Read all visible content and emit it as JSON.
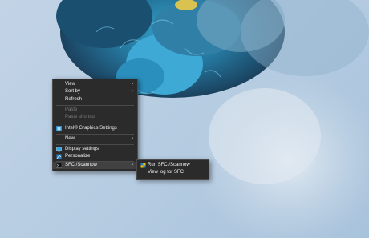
{
  "desktop": {
    "context_menu": {
      "items": [
        {
          "label": "View",
          "has_submenu": true
        },
        {
          "label": "Sort by",
          "has_submenu": true
        },
        {
          "label": "Refresh"
        },
        {
          "label": "Paste",
          "disabled": true
        },
        {
          "label": "Paste shortcut",
          "disabled": true
        },
        {
          "label": "Intel® Graphics Settings",
          "icon": "intel-graphics-icon"
        },
        {
          "label": "New",
          "has_submenu": true
        },
        {
          "label": "Display settings",
          "icon": "display-icon"
        },
        {
          "label": "Personalize",
          "icon": "personalize-icon"
        },
        {
          "label": "SFC /Scannow",
          "icon": "terminal-icon",
          "has_submenu": true,
          "active": true
        }
      ],
      "submenu": {
        "items": [
          {
            "label": "Run SFC /Scannow",
            "icon": "shield-icon"
          },
          {
            "label": "View log for SFC"
          }
        ]
      }
    },
    "colors": {
      "menu_bg": "#2b2b2b",
      "menu_text": "#f0f0f0",
      "menu_active": "#414141"
    }
  }
}
